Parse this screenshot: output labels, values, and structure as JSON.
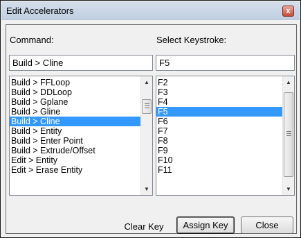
{
  "window": {
    "title": "Edit Accelerators",
    "close_label": "x"
  },
  "command": {
    "label": "Command:",
    "value": "Build > Cline",
    "items": [
      "Build > FFLoop",
      "Build > DDLoop",
      "Build > Gplane",
      "Build > Gline",
      "Build > Cline",
      "Build > Entity",
      "Build > Enter Point",
      "Build > Extrude/Offset",
      "Edit > Entity",
      "Edit > Erase Entity"
    ],
    "selected": "Build > Cline"
  },
  "keystroke": {
    "label": "Select Keystroke:",
    "value": "F5",
    "items": [
      "F2",
      "F3",
      "F4",
      "F5",
      "F6",
      "F7",
      "F8",
      "F9",
      "F10",
      "F11"
    ],
    "selected": "F5"
  },
  "buttons": {
    "clear": "Clear Key",
    "assign": "Assign Key",
    "close": "Close"
  },
  "colors": {
    "selection": "#3399ff",
    "titlebar": "#c8d6e6"
  }
}
